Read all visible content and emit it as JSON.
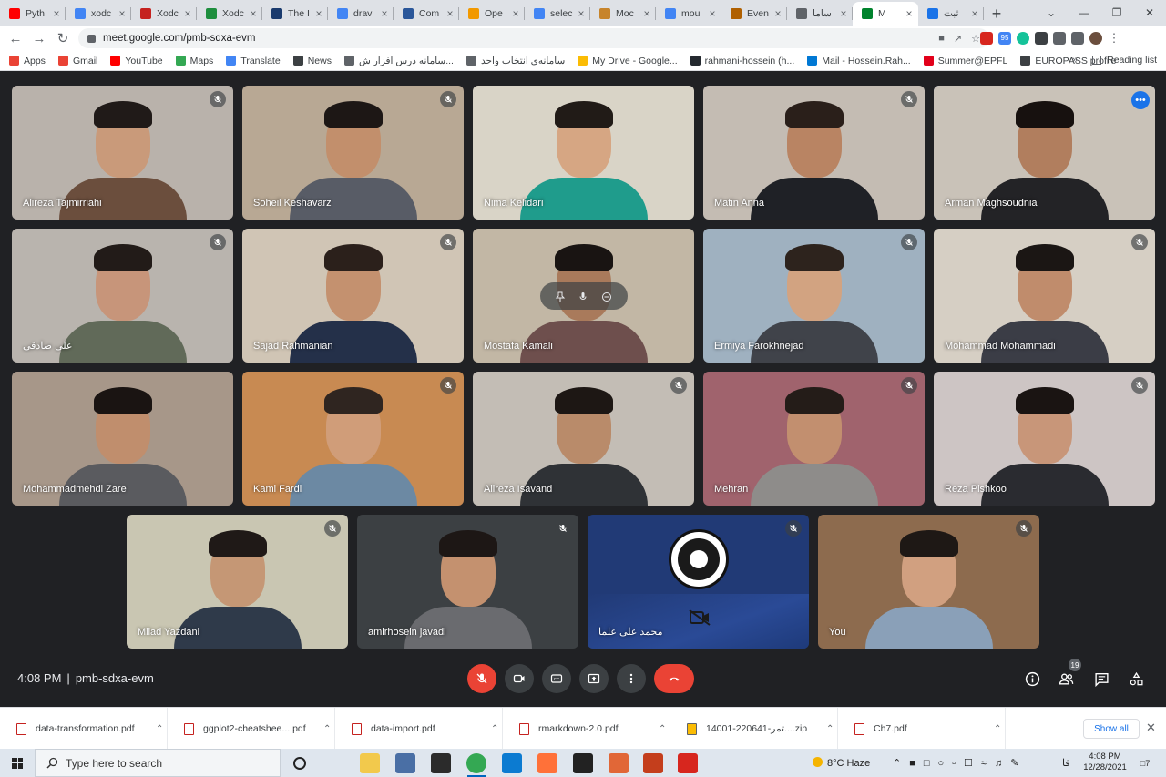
{
  "browser": {
    "tabs": [
      {
        "label": "Pyth",
        "color": "#ff0000"
      },
      {
        "label": "xodc",
        "color": "#4285f4"
      },
      {
        "label": "Xodc",
        "color": "#c5221f"
      },
      {
        "label": "Xodc",
        "color": "#1e8e3e"
      },
      {
        "label": "The I",
        "color": "#1a3b6e"
      },
      {
        "label": "drav",
        "color": "#4285f4"
      },
      {
        "label": "Com",
        "color": "#2b579a"
      },
      {
        "label": "Ope",
        "color": "#f29900"
      },
      {
        "label": "selec",
        "color": "#4285f4"
      },
      {
        "label": "Moc",
        "color": "#c7842b"
      },
      {
        "label": "mou",
        "color": "#4285f4"
      },
      {
        "label": "Even",
        "color": "#b06000"
      },
      {
        "label": "ساما",
        "color": "#5f6368"
      },
      {
        "label": "M",
        "color": "#00832d",
        "active": true
      },
      {
        "label": "ثبت",
        "color": "#1a73e8"
      }
    ],
    "new_tab": "+",
    "url": "meet.google.com/pmb-sdxa-evm",
    "bookmarks": [
      {
        "label": "Apps",
        "color": "#ea4335"
      },
      {
        "label": "Gmail",
        "color": "#ea4335"
      },
      {
        "label": "YouTube",
        "color": "#ff0000"
      },
      {
        "label": "Maps",
        "color": "#34a853"
      },
      {
        "label": "Translate",
        "color": "#4285f4"
      },
      {
        "label": "News",
        "color": "#3c4043"
      },
      {
        "label": "سامانه درس افزار ش...",
        "color": "#5f6368"
      },
      {
        "label": "سامانه‌ی انتخاب واحد",
        "color": "#5f6368"
      },
      {
        "label": "My Drive - Google...",
        "color": "#fbbc04"
      },
      {
        "label": "rahmani-hossein (h...",
        "color": "#24292f"
      },
      {
        "label": "Mail - Hossein.Rah...",
        "color": "#0078d4"
      },
      {
        "label": "Summer@EPFL",
        "color": "#e2001a"
      },
      {
        "label": "EUROPASS profile",
        "color": "#3c4043"
      }
    ],
    "bookmarks_overflow": "»",
    "reading_list": "Reading list",
    "extension_badge": "95"
  },
  "participants": [
    {
      "name": "Alireza Tajmirriahi",
      "muted": true,
      "bg": "#b9b2ab",
      "skin": "#c99a7a",
      "hair": "#201a18",
      "shirt": "#6b4e3d"
    },
    {
      "name": "Soheil Keshavarz",
      "muted": true,
      "bg": "#b8a894",
      "skin": "#c28f6c",
      "hair": "#1d1715",
      "shirt": "#585c66"
    },
    {
      "name": "Nima Kelidari",
      "muted": false,
      "bg": "#d9d4c7",
      "skin": "#d6a683",
      "hair": "#211b17",
      "shirt": "#1f9c8c"
    },
    {
      "name": "Matin Anna",
      "muted": true,
      "bg": "#c4bcb3",
      "skin": "#b98463",
      "hair": "#2a1f1a",
      "shirt": "#1f2126"
    },
    {
      "name": "Arman Maghsoudnia",
      "muted": false,
      "bg": "#c9c2b8",
      "skin": "#b17e5e",
      "hair": "#17110f",
      "shirt": "#232326",
      "speaking": true,
      "menu": true
    },
    {
      "name": "علی صادقی",
      "muted": true,
      "bg": "#b9b4ae",
      "skin": "#c7957a",
      "hair": "#221b18",
      "shirt": "#616a59"
    },
    {
      "name": "Sajad Rahmanian",
      "muted": true,
      "bg": "#d0c5b5",
      "skin": "#c4916f",
      "hair": "#2b201b",
      "shirt": "#243049"
    },
    {
      "name": "Mostafa Kamali",
      "muted": false,
      "bg": "#c2b7a5",
      "skin": "#a97a5b",
      "hair": "#191412",
      "shirt": "#6e4f4d",
      "hover": true
    },
    {
      "name": "Ermiya Farokhnejad",
      "muted": true,
      "bg": "#9fb1c0",
      "skin": "#d2a381",
      "hair": "#2d231d",
      "shirt": "#40434a"
    },
    {
      "name": "Mohammad Mohammadi",
      "muted": true,
      "bg": "#d6cfc4",
      "skin": "#c08c6c",
      "hair": "#1b1614",
      "shirt": "#3b3d46"
    },
    {
      "name": "Mohammadmehdi Zare",
      "muted": false,
      "bg": "#a79789",
      "skin": "#c08e6d",
      "hair": "#1a1412",
      "shirt": "#5a5b5f"
    },
    {
      "name": "Kami Fardi",
      "muted": true,
      "bg": "#c88a52",
      "skin": "#d09d79",
      "hair": "#2f2520",
      "shirt": "#6c89a3"
    },
    {
      "name": "Alireza Isavand",
      "muted": true,
      "bg": "#c3bdb5",
      "skin": "#b98b6a",
      "hair": "#1d1714",
      "shirt": "#2f3236"
    },
    {
      "name": "Mehran",
      "muted": true,
      "bg": "#a0636d",
      "skin": "#c28f6f",
      "hair": "#241c18",
      "shirt": "#8e8c8a"
    },
    {
      "name": "Reza Pishkoo",
      "muted": true,
      "bg": "#cdc5c4",
      "skin": "#c89679",
      "hair": "#1a1412",
      "shirt": "#2a2b30"
    },
    {
      "name": "Milad Yazdani",
      "muted": true,
      "bg": "#c9c6b2",
      "skin": "#c59775",
      "hair": "#1f1917",
      "shirt": "#2f3a4a"
    },
    {
      "name": "amirhosein javadi",
      "muted": true,
      "bg": "#3c4043",
      "skin": "#c4916f",
      "hair": "#1d1715",
      "shirt": "#6a6b6f"
    },
    {
      "name": "محمد علی علما",
      "muted": true,
      "bg": "#213a76",
      "camera_off": true
    },
    {
      "name": "You",
      "muted": true,
      "bg": "#8d6b4e",
      "skin": "#d1a080",
      "hair": "#1e1815",
      "shirt": "#8aa0b8"
    }
  ],
  "meeting": {
    "time": "4:08 PM",
    "separator": "|",
    "code": "pmb-sdxa-evm",
    "participant_count": "19"
  },
  "downloads": {
    "files": [
      {
        "name": "data-transformation.pdf",
        "type": "pdf"
      },
      {
        "name": "ggplot2-cheatshee....pdf",
        "type": "pdf"
      },
      {
        "name": "data-import.pdf",
        "type": "pdf"
      },
      {
        "name": "rmarkdown-2.0.pdf",
        "type": "pdf"
      },
      {
        "name": "14001-220641-تمر....zip",
        "type": "zip"
      },
      {
        "name": "Ch7.pdf",
        "type": "pdf"
      }
    ],
    "show_all": "Show all",
    "close": "✕"
  },
  "taskbar": {
    "search_placeholder": "Type here to search",
    "weather": "8°C  Haze",
    "language": "فا",
    "time": "4:08 PM",
    "date": "12/28/2021",
    "notifications": "7",
    "apps": [
      {
        "name": "cortana",
        "color": "#222222"
      },
      {
        "name": "task-view",
        "color": "#333333"
      },
      {
        "name": "file-explorer",
        "color": "#f2c94c"
      },
      {
        "name": "store",
        "color": "#4a6fa5"
      },
      {
        "name": "mail",
        "color": "#2b2b2b"
      },
      {
        "name": "chrome",
        "color": "#34a853",
        "active": true
      },
      {
        "name": "edge",
        "color": "#0c7bd1"
      },
      {
        "name": "firefox",
        "color": "#ff7139"
      },
      {
        "name": "clapper",
        "color": "#222222"
      },
      {
        "name": "matlab",
        "color": "#e16737"
      },
      {
        "name": "powerpoint",
        "color": "#c43e1c"
      },
      {
        "name": "acrobat",
        "color": "#d7261e"
      }
    ]
  }
}
